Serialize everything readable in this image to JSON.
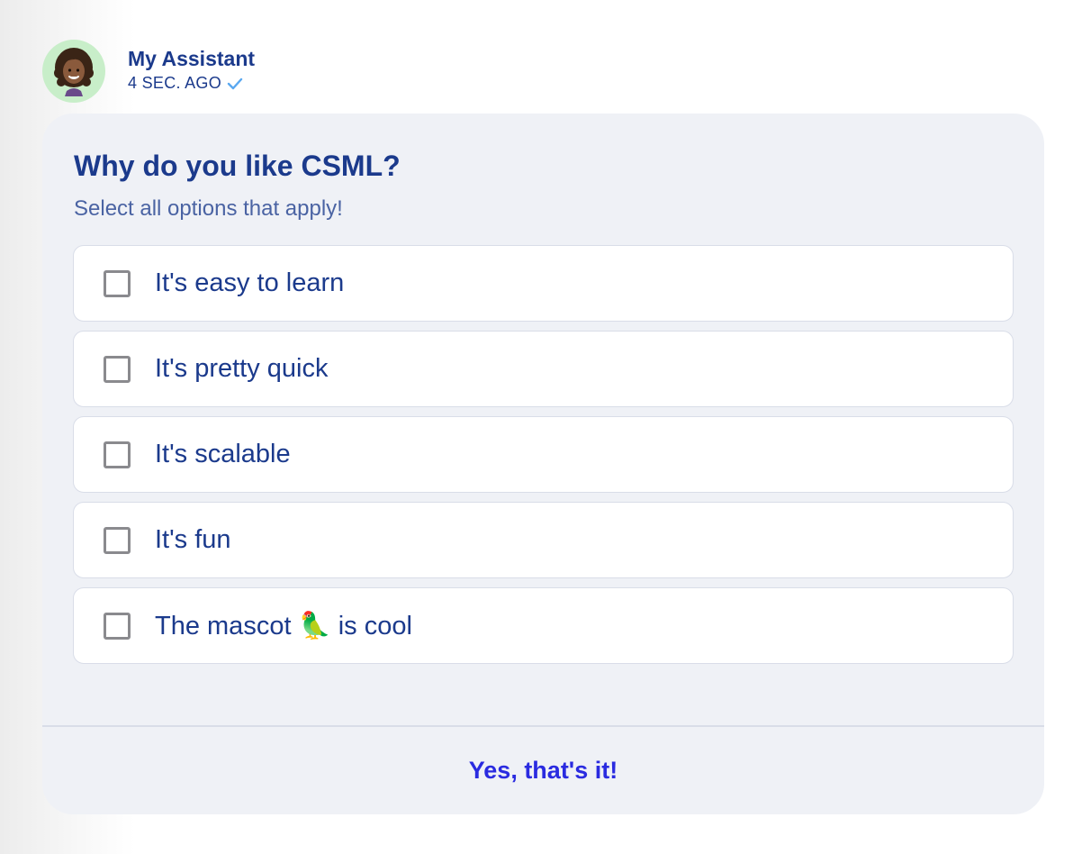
{
  "message": {
    "sender": "My Assistant",
    "time": "4 SEC. AGO",
    "avatar_icon": "woman-avatar-icon",
    "avatar_bg": "#c8eec9",
    "status_icon": "check-icon",
    "status_color": "#5aa8f0"
  },
  "question": {
    "title": "Why do you like CSML?",
    "subtitle": "Select all options that apply!",
    "options": [
      {
        "label": "It's easy to learn",
        "checked": false
      },
      {
        "label": "It's pretty quick",
        "checked": false
      },
      {
        "label": "It's scalable",
        "checked": false
      },
      {
        "label": "It's fun",
        "checked": false
      },
      {
        "label": "The mascot 🦜 is cool",
        "checked": false
      }
    ],
    "submit_label": "Yes, that's it!"
  },
  "colors": {
    "text_primary": "#1b3a8c",
    "text_secondary": "#4a63a3",
    "card_bg": "#eff1f6",
    "accent": "#2a2be0"
  }
}
